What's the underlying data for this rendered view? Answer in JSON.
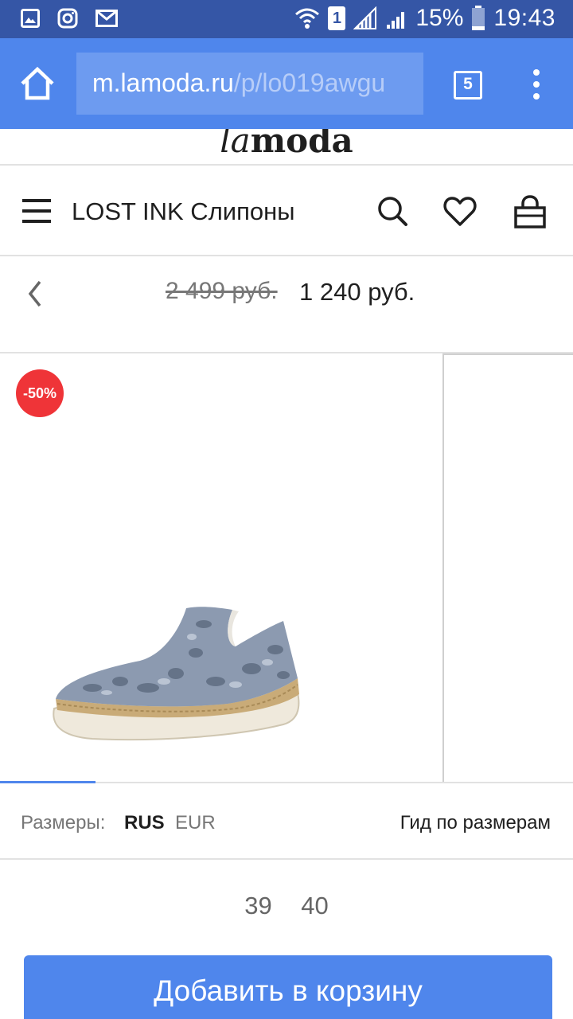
{
  "status_bar": {
    "battery": "15%",
    "time": "19:43",
    "sim_slot": "1",
    "icons": [
      "gallery-icon",
      "instagram-icon",
      "mail-icon",
      "wifi-icon",
      "sim-icon",
      "signal-icon",
      "signal-icon",
      "battery-icon"
    ]
  },
  "browser": {
    "url_host": "m.lamoda.ru",
    "url_path": "/p/lo019awgu",
    "tab_count": "5"
  },
  "site": {
    "logo_la": "la",
    "logo_moda": "moda"
  },
  "nav": {
    "title": "LOST INK Слипоны"
  },
  "price": {
    "old": "2 499 руб.",
    "current": "1 240 руб."
  },
  "gallery": {
    "discount_badge": "-50%",
    "progress_fraction": 0.167
  },
  "sizes": {
    "label": "Размеры:",
    "rus": "RUS",
    "eur": "EUR",
    "guide": "Гид по размерам",
    "options": [
      "39",
      "40"
    ]
  },
  "cart": {
    "label": "Добавить в корзину"
  },
  "colors": {
    "status_bar": "#3556a6",
    "toolbar": "#4f86ec",
    "accent": "#4f86ec",
    "badge": "#ef3438"
  }
}
